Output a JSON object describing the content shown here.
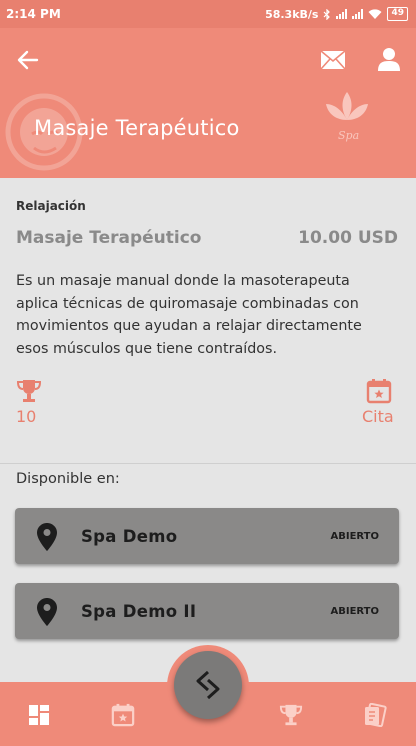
{
  "status_bar": {
    "time": "2:14 PM",
    "network_speed": "58.3kB/s",
    "battery": "49"
  },
  "header": {
    "title": "Masaje Terapéutico",
    "logo_text": "Spa"
  },
  "service": {
    "category": "Relajación",
    "name": "Masaje Terapéutico",
    "price": "10.00 USD",
    "description": "Es un masaje manual donde la masoterapeuta aplica técnicas de quiromasaje combinadas con movimientos que ayudan a relajar directamente esos músculos que tiene contraídos.",
    "points": "10",
    "appointment_label": "Cita"
  },
  "availability": {
    "label": "Disponible en:",
    "locations": [
      {
        "name": "Spa Demo",
        "status": "ABIERTO"
      },
      {
        "name": "Spa Demo II",
        "status": "ABIERTO"
      }
    ]
  },
  "colors": {
    "primary": "#ef8a79",
    "accent_text": "#e8806f",
    "card": "#8a8988",
    "background": "#e5e5e5"
  },
  "icons": {
    "back": "arrow-left-icon",
    "mail": "mail-icon",
    "user": "user-icon",
    "points": "trophy-icon",
    "appointment": "calendar-star-icon",
    "location": "map-pin-icon",
    "nav": [
      "dashboard-icon",
      "calendar-star-icon",
      "swap-icon",
      "trophy-icon",
      "coupon-icon"
    ]
  }
}
